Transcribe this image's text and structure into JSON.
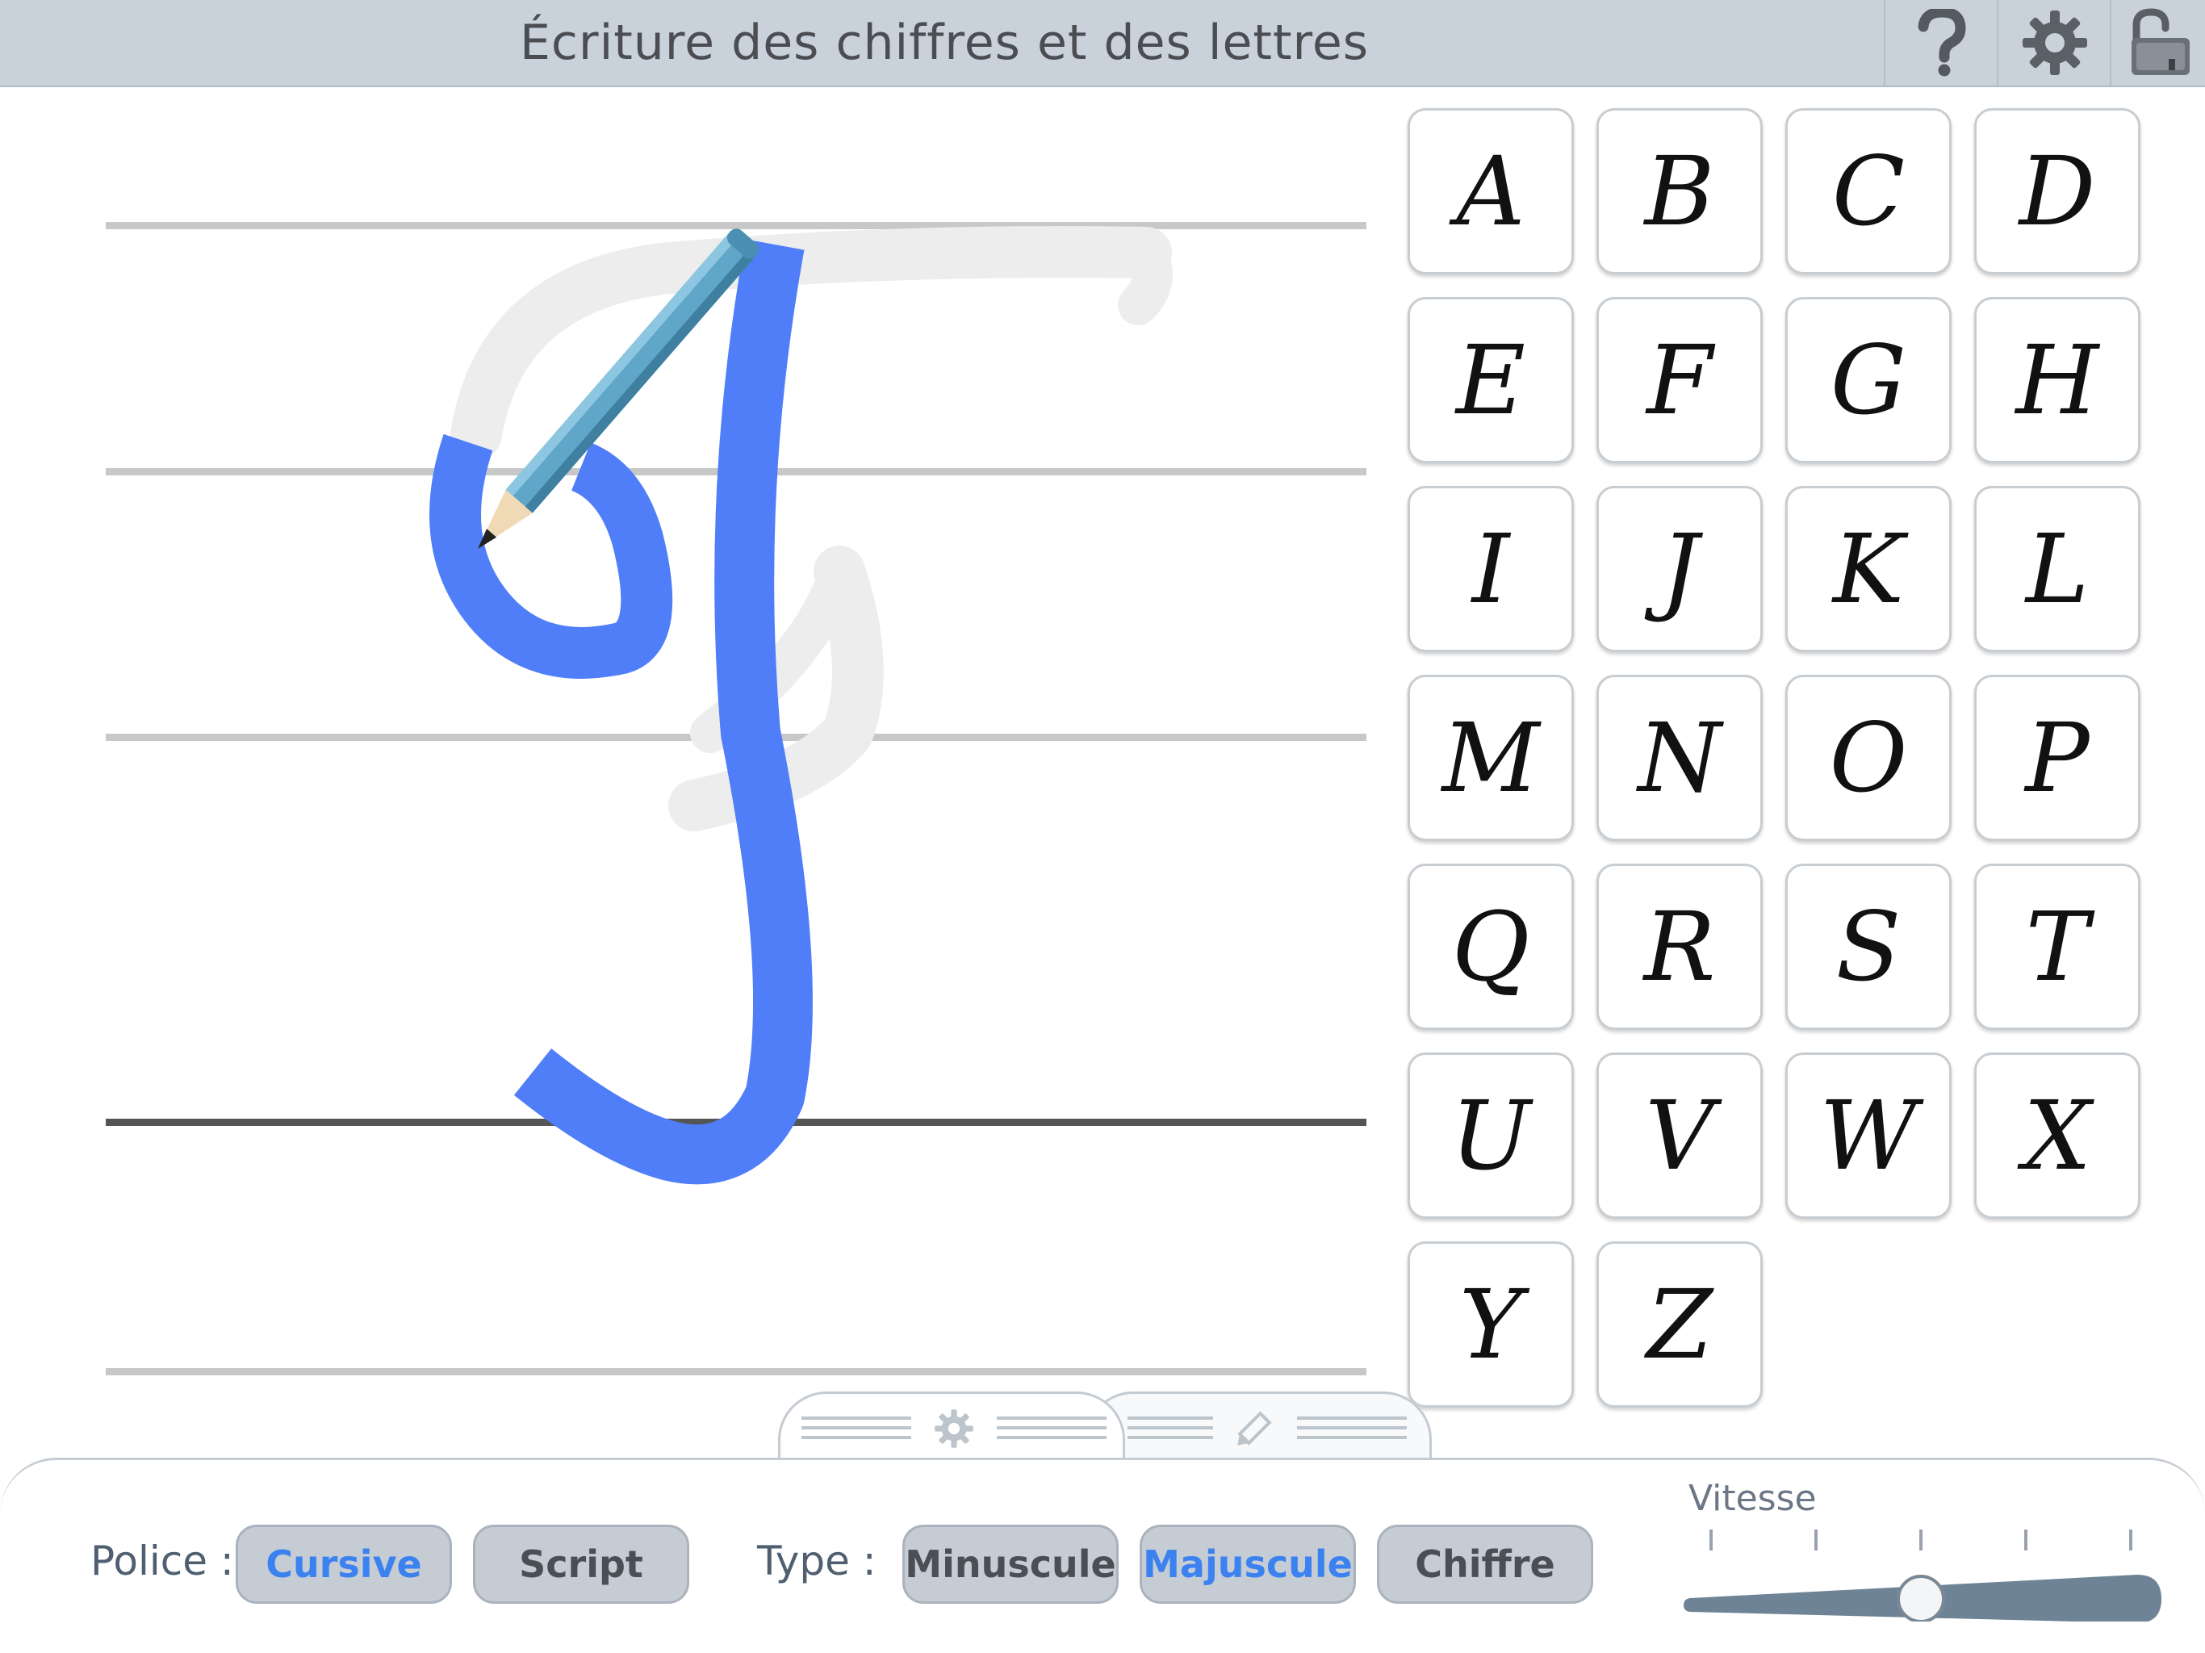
{
  "header": {
    "title": "Écriture des chiffres et des lettres",
    "help_icon": "question-mark-icon",
    "settings_icon": "gear-icon",
    "lock_icon": "unlocked-padlock-icon"
  },
  "canvas": {
    "current_letter": "J",
    "stroke_color": "#4f7ef8",
    "guide_color": "#efefef",
    "tool_icon": "pencil-icon"
  },
  "letters": [
    "A",
    "B",
    "C",
    "D",
    "E",
    "F",
    "G",
    "H",
    "I",
    "J",
    "K",
    "L",
    "M",
    "N",
    "O",
    "P",
    "Q",
    "R",
    "S",
    "T",
    "U",
    "V",
    "W",
    "X",
    "Y",
    "Z"
  ],
  "tabs": [
    {
      "icon": "gear-icon"
    },
    {
      "icon": "pencil-icon"
    }
  ],
  "controls": {
    "police_label": "Police :",
    "police_options": [
      "Cursive",
      "Script"
    ],
    "police_selected": "Cursive",
    "type_label": "Type :",
    "type_options": [
      "Minuscule",
      "Majuscule",
      "Chiffre"
    ],
    "type_selected": "Majuscule",
    "speed_label": "Vitesse",
    "speed_value": 0.5
  },
  "colors": {
    "accent": "#3b82f0",
    "header_bg": "#c9d1da",
    "pill_bg": "#c5ccd4"
  }
}
